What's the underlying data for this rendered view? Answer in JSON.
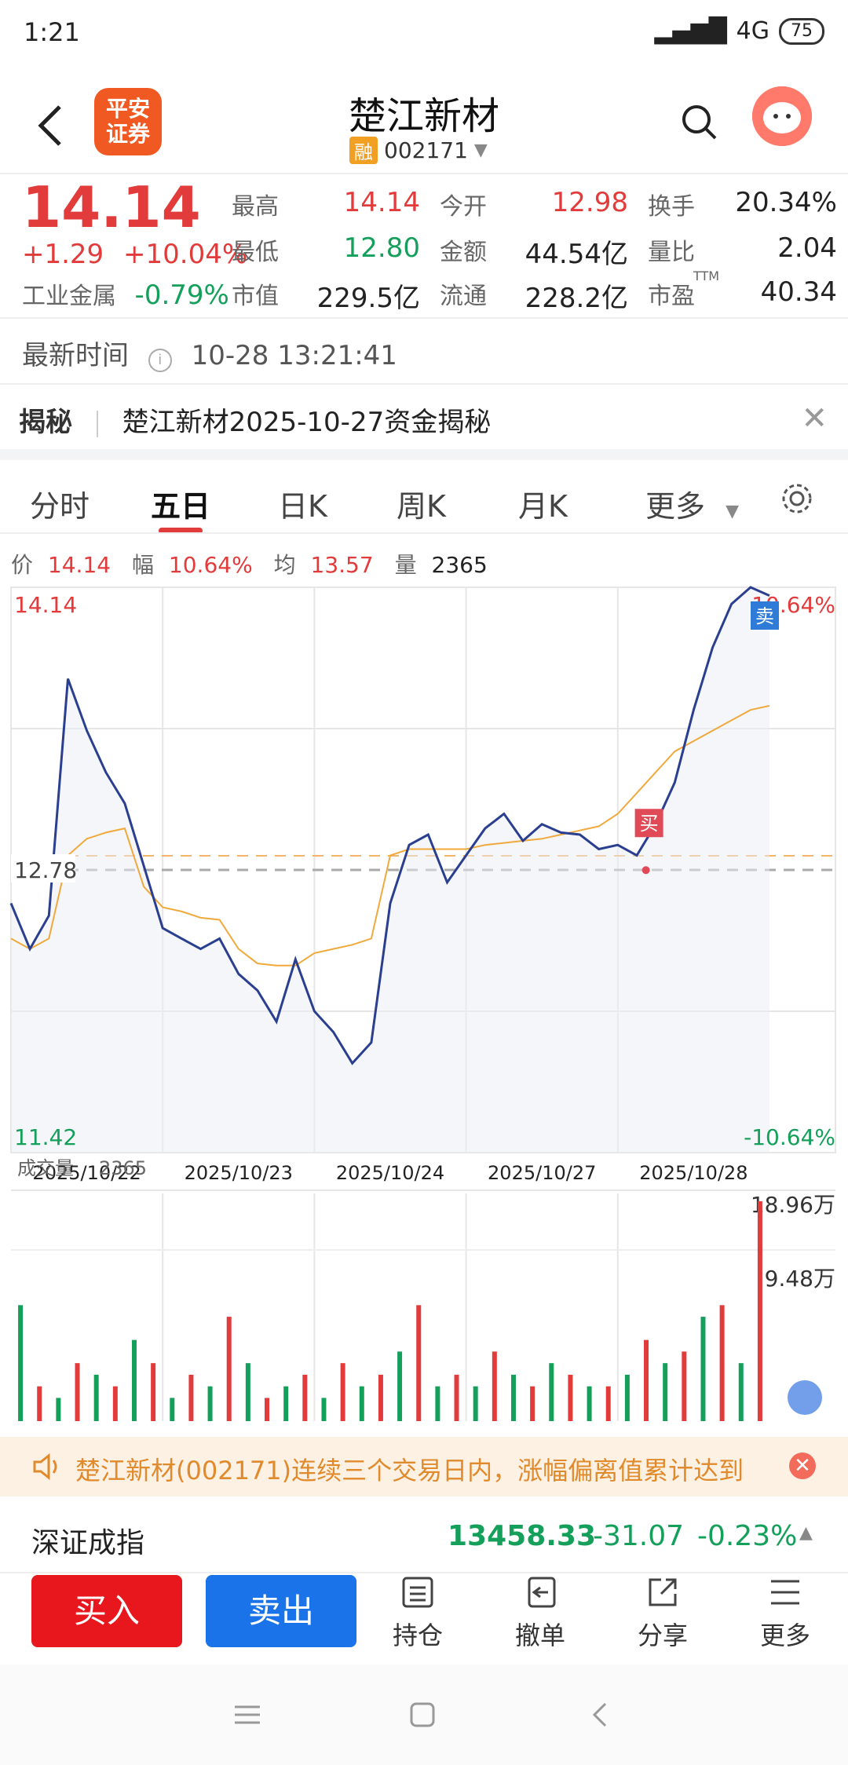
{
  "status": {
    "time": "1:21",
    "network": "4G",
    "battery": "75"
  },
  "header": {
    "broker_logo_line1": "平安",
    "broker_logo_line2": "证券",
    "title": "楚江新材",
    "rong_badge": "融",
    "code": "002171"
  },
  "quote": {
    "price": "14.14",
    "change": "+1.29",
    "change_pct": "+10.04%",
    "industry_name": "工业金属",
    "industry_chg": "-0.79%",
    "fields": [
      {
        "label": "最高",
        "value": "14.14",
        "color": "red"
      },
      {
        "label": "今开",
        "value": "12.98",
        "color": "red"
      },
      {
        "label": "换手",
        "value": "20.34%",
        "color": "dark"
      },
      {
        "label": "最低",
        "value": "12.80",
        "color": "green"
      },
      {
        "label": "金额",
        "value": "44.54亿",
        "color": "dark"
      },
      {
        "label": "量比",
        "value": "2.04",
        "color": "dark"
      },
      {
        "label": "市值",
        "value": "229.5亿",
        "color": "dark"
      },
      {
        "label": "流通",
        "value": "228.2亿",
        "color": "dark"
      },
      {
        "label": "市盈",
        "value": "40.34",
        "color": "dark",
        "sup": "TTM"
      }
    ]
  },
  "latest": {
    "label": "最新时间",
    "value": "10-28 13:21:41"
  },
  "reveal": {
    "tag": "揭秘",
    "text": "楚江新材2025-10-27资金揭秘"
  },
  "tabs": [
    "分时",
    "五日",
    "日K",
    "周K",
    "月K",
    "更多"
  ],
  "active_tab": "五日",
  "info": {
    "price_label": "价",
    "price": "14.14",
    "amp_label": "幅",
    "amp": "10.64%",
    "avg_label": "均",
    "avg": "13.57",
    "vol_label": "量",
    "vol": "2365"
  },
  "chart_data": {
    "type": "line",
    "x_labels": [
      "2025/10/22",
      "2025/10/23",
      "2025/10/24",
      "2025/10/27",
      "2025/10/28"
    ],
    "y_max_label": "14.14",
    "y_mid_label": "12.78",
    "y_min_label": "11.42",
    "pct_max_label": "10.64%",
    "pct_min_label": "-10.64%",
    "ylim": [
      11.42,
      14.14
    ],
    "series": [
      {
        "values": [
          12.62,
          12.4,
          12.56,
          13.7,
          13.45,
          13.25,
          13.1,
          12.8,
          12.5,
          12.45,
          12.4,
          12.45,
          12.28,
          12.2,
          12.05,
          12.35,
          12.1,
          12.0,
          11.85,
          11.95,
          12.62,
          12.9,
          12.95,
          12.72,
          12.85,
          12.98,
          13.05,
          12.92,
          13.0,
          12.96,
          12.95,
          12.88,
          12.9,
          12.85,
          13.0,
          13.2,
          13.55,
          13.85,
          14.06,
          14.14,
          14.1
        ]
      },
      {
        "values": [
          12.45,
          12.4,
          12.45,
          12.85,
          12.93,
          12.96,
          12.98,
          12.7,
          12.6,
          12.58,
          12.55,
          12.54,
          12.4,
          12.33,
          12.32,
          12.32,
          12.38,
          12.4,
          12.42,
          12.45,
          12.85,
          12.88,
          12.88,
          12.88,
          12.88,
          12.9,
          12.91,
          12.92,
          12.93,
          12.95,
          12.97,
          12.99,
          13.05,
          13.15,
          13.25,
          13.35,
          13.4,
          13.45,
          13.5,
          13.55,
          13.57
        ]
      }
    ],
    "markers": {
      "buy": "买",
      "sell": "卖"
    },
    "volume": {
      "label": "成交量",
      "value": "2365",
      "max_label": "18.96万",
      "mid_label": "9.48万",
      "values": [
        10,
        3,
        2,
        5,
        4,
        3,
        7,
        5,
        2,
        4,
        3,
        9,
        5,
        2,
        3,
        4,
        2,
        5,
        3,
        4,
        6,
        10,
        3,
        4,
        3,
        6,
        4,
        3,
        5,
        4,
        3,
        3,
        4,
        7,
        5,
        6,
        9,
        10,
        5,
        18.96
      ]
    }
  },
  "notice": {
    "text": "楚江新材(002171)连续三个交易日内，涨幅偏离值累计达到"
  },
  "index": {
    "name": "深证成指",
    "value": "13458.33",
    "change": "-31.07",
    "change_pct": "-0.23%"
  },
  "actions": {
    "buy": "买入",
    "sell": "卖出",
    "hold": "持仓",
    "cancel": "撤单",
    "share": "分享",
    "more": "更多"
  }
}
